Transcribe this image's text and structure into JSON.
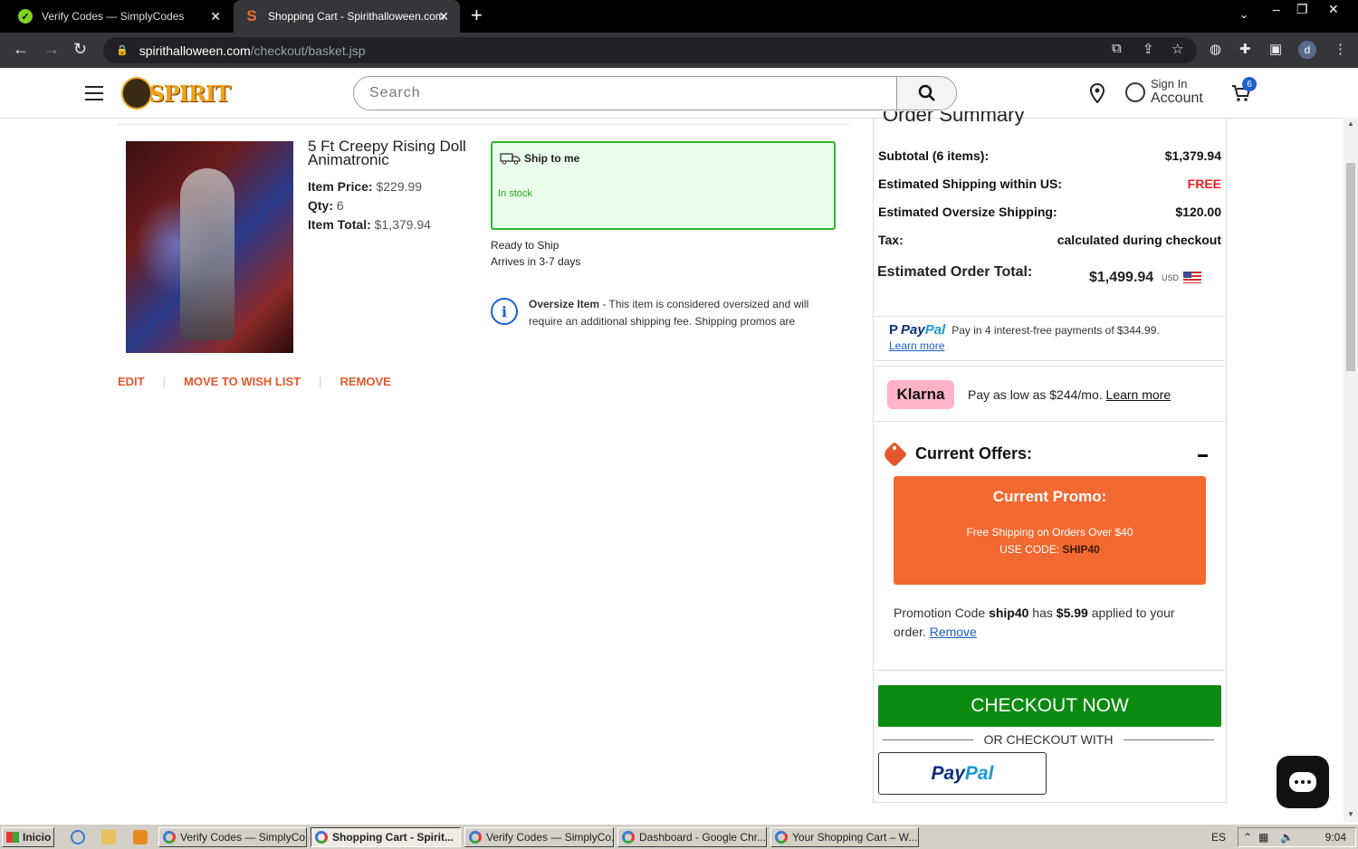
{
  "browser": {
    "tabs": [
      {
        "title": "Verify Codes — SimplyCodes",
        "active": false
      },
      {
        "title": "Shopping Cart - Spirithalloween.com",
        "active": true
      }
    ],
    "url_host": "spirithalloween.com",
    "url_path": "/checkout/basket.jsp",
    "profile_initial": "d"
  },
  "header": {
    "logo_text": "SPIRIT",
    "search_placeholder": "Search",
    "sign_in": "Sign In",
    "account": "Account",
    "cart_count": "6"
  },
  "summary_heading": "Order Summary",
  "product": {
    "name": "5 Ft Creepy Rising Doll Animatronic",
    "price_label": "Item Price:",
    "price": "$229.99",
    "qty_label": "Qty:",
    "qty": "6",
    "total_label": "Item Total:",
    "total": "$1,379.94",
    "ship_option": "Ship to me",
    "stock_status": "In stock",
    "ready": "Ready to Ship",
    "arrives": "Arrives in 3-7 days",
    "oversize_title": "Oversize Item",
    "oversize_text": " - This item is considered oversized and will require an additional shipping fee. Shipping promos are",
    "actions": {
      "edit": "EDIT",
      "wishlist": "MOVE TO WISH LIST",
      "remove": "REMOVE"
    }
  },
  "summary": {
    "rows": [
      {
        "label": "Subtotal (6 items):",
        "value": "$1,379.94"
      },
      {
        "label": "Estimated Shipping within US:",
        "value": "FREE"
      },
      {
        "label": "Estimated Oversize Shipping:",
        "value": "$120.00"
      },
      {
        "label": "Tax:",
        "value": "calculated during checkout"
      }
    ],
    "total_label": "Estimated Order Total:",
    "total_value": "$1,499.94",
    "currency": "USD"
  },
  "paypal_offer": {
    "brand_a": "Pay",
    "brand_b": "Pal",
    "text": "Pay in 4 interest-free payments of $344.99.",
    "learn_more": "Learn more"
  },
  "klarna": {
    "brand": "Klarna",
    "text": "Pay as low as $244/mo.",
    "learn_more": "Learn more"
  },
  "offers": {
    "title": "Current Offers:",
    "promo_title": "Current Promo:",
    "promo_desc": "Free Shipping on Orders Over $40",
    "promo_code_label": "USE CODE: ",
    "promo_code": "SHIP40",
    "applied_prefix": "Promotion Code ",
    "applied_code": "ship40",
    "applied_mid": " has ",
    "applied_amount": "$5.99",
    "applied_suffix": " applied to your order. ",
    "remove": "Remove"
  },
  "checkout": {
    "button": "CHECKOUT NOW",
    "or_text": "OR CHECKOUT WITH",
    "paypal_a": "Pay",
    "paypal_b": "Pal"
  },
  "taskbar": {
    "start": "Inicio",
    "tasks": [
      "Verify Codes — SimplyCo...",
      "Shopping Cart - Spirit...",
      "Verify Codes — SimplyCo...",
      "Dashboard - Google Chr...",
      "Your Shopping Cart – W..."
    ],
    "lang": "ES",
    "time": "9:04"
  },
  "colors": {
    "accent_orange": "#f26a31",
    "checkout_green": "#0a8a10",
    "free_red": "#e8231f",
    "link_blue": "#1d5fd0"
  }
}
